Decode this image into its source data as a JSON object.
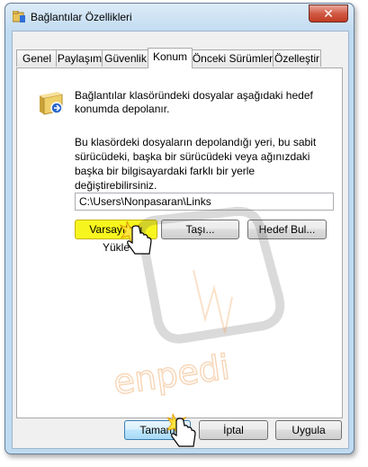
{
  "window": {
    "title": "Bağlantılar Özellikleri",
    "close_glyph": "✕",
    "icon": "folder-properties-icon"
  },
  "tabs": [
    {
      "label": "Genel"
    },
    {
      "label": "Paylaşım"
    },
    {
      "label": "Güvenlik"
    },
    {
      "label": "Konum",
      "active": true
    },
    {
      "label": "Önceki Sürümler"
    },
    {
      "label": "Özelleştir"
    }
  ],
  "location": {
    "description_1": "Bağlantılar klasöründeki dosyalar aşağıdaki hedef konumda depolanır.",
    "description_2": "Bu klasördeki dosyaların depolandığı yeri, bu sabit sürücüdeki, başka bir sürücüdeki veya ağınızdaki başka bir bilgisayardaki farklı bir yerle değiştirebilirsiniz.",
    "path_value": "C:\\Users\\Nonpasaran\\Links",
    "restore_default_label": "Varsayılanı Yükle",
    "move_label": "Taşı...",
    "find_target_label": "Hedef Bul..."
  },
  "footer": {
    "ok_label": "Tamam",
    "cancel_label": "İptal",
    "apply_label": "Uygula"
  },
  "watermark": {
    "text": "enpedi"
  },
  "colors": {
    "highlight": "#f7f51e",
    "frame": "#bfdbf2",
    "close": "#c23b23"
  }
}
